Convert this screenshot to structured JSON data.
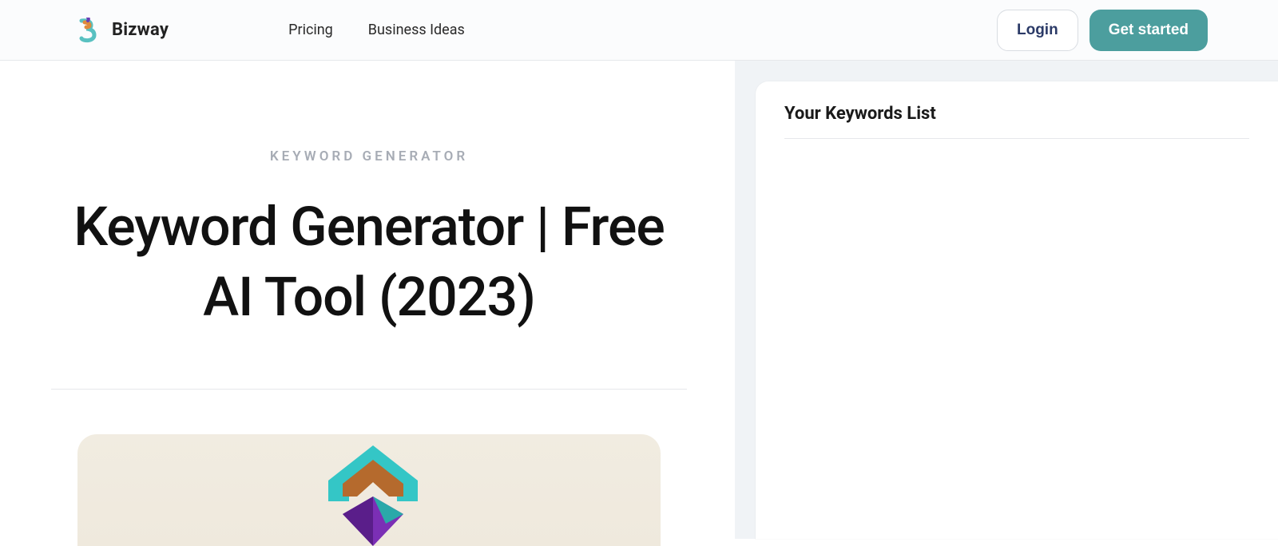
{
  "brand": {
    "name": "Bizway"
  },
  "nav": {
    "links": [
      {
        "label": "Pricing"
      },
      {
        "label": "Business Ideas"
      }
    ],
    "login_label": "Login",
    "get_started_label": "Get started"
  },
  "article": {
    "eyebrow": "KEYWORD GENERATOR",
    "title": "Keyword Generator | Free AI Tool (2023)"
  },
  "side_panel": {
    "title": "Your Keywords List"
  },
  "colors": {
    "accent": "#4c9e9e"
  }
}
